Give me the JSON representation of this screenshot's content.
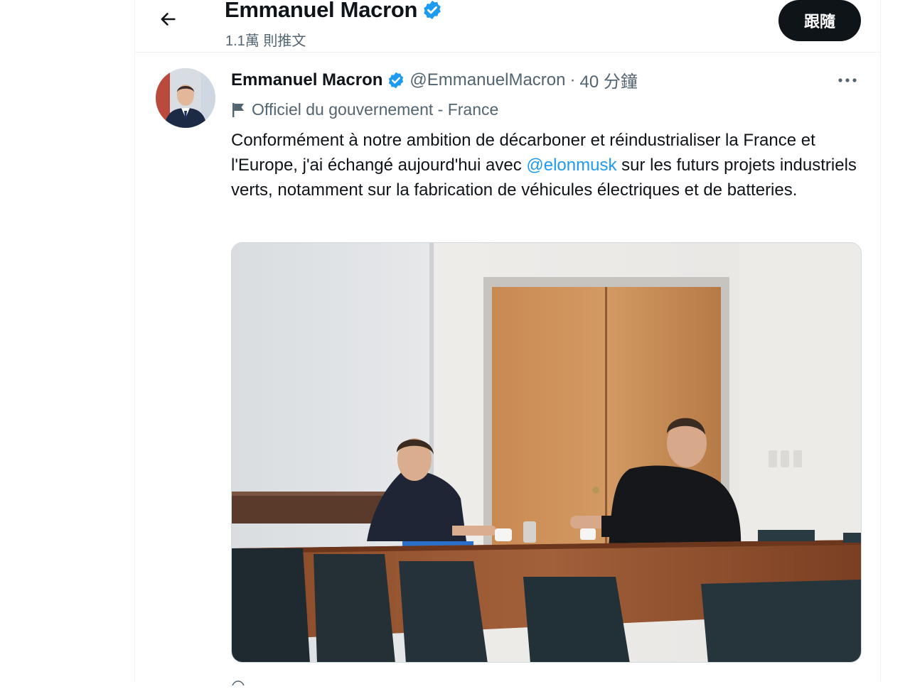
{
  "header": {
    "name": "Emmanuel Macron",
    "tweet_count": "1.1萬 則推文",
    "follow_label": "跟隨"
  },
  "tweet": {
    "author_name": "Emmanuel Macron",
    "handle": "@EmmanuelMacron",
    "separator": "·",
    "time": "40 分鐘",
    "gov_label": "Officiel du gouvernement - France",
    "text_before": "Conformément à notre ambition de décarboner et réindustrialiser la France et l'Europe, j'ai échangé aujourd'hui avec ",
    "mention": "@elonmusk",
    "text_after": " sur les futurs projets industriels verts, notamment sur la fabrication de véhicules électriques et de batteries."
  },
  "icons": {
    "back": "arrow-left-icon",
    "verified": "verified-badge-icon",
    "more": "more-horizontal-icon",
    "flag": "flag-icon"
  },
  "colors": {
    "accent": "#1d9bf0",
    "text": "#0f1419",
    "secondary": "#536471",
    "button": "#0f1419"
  }
}
